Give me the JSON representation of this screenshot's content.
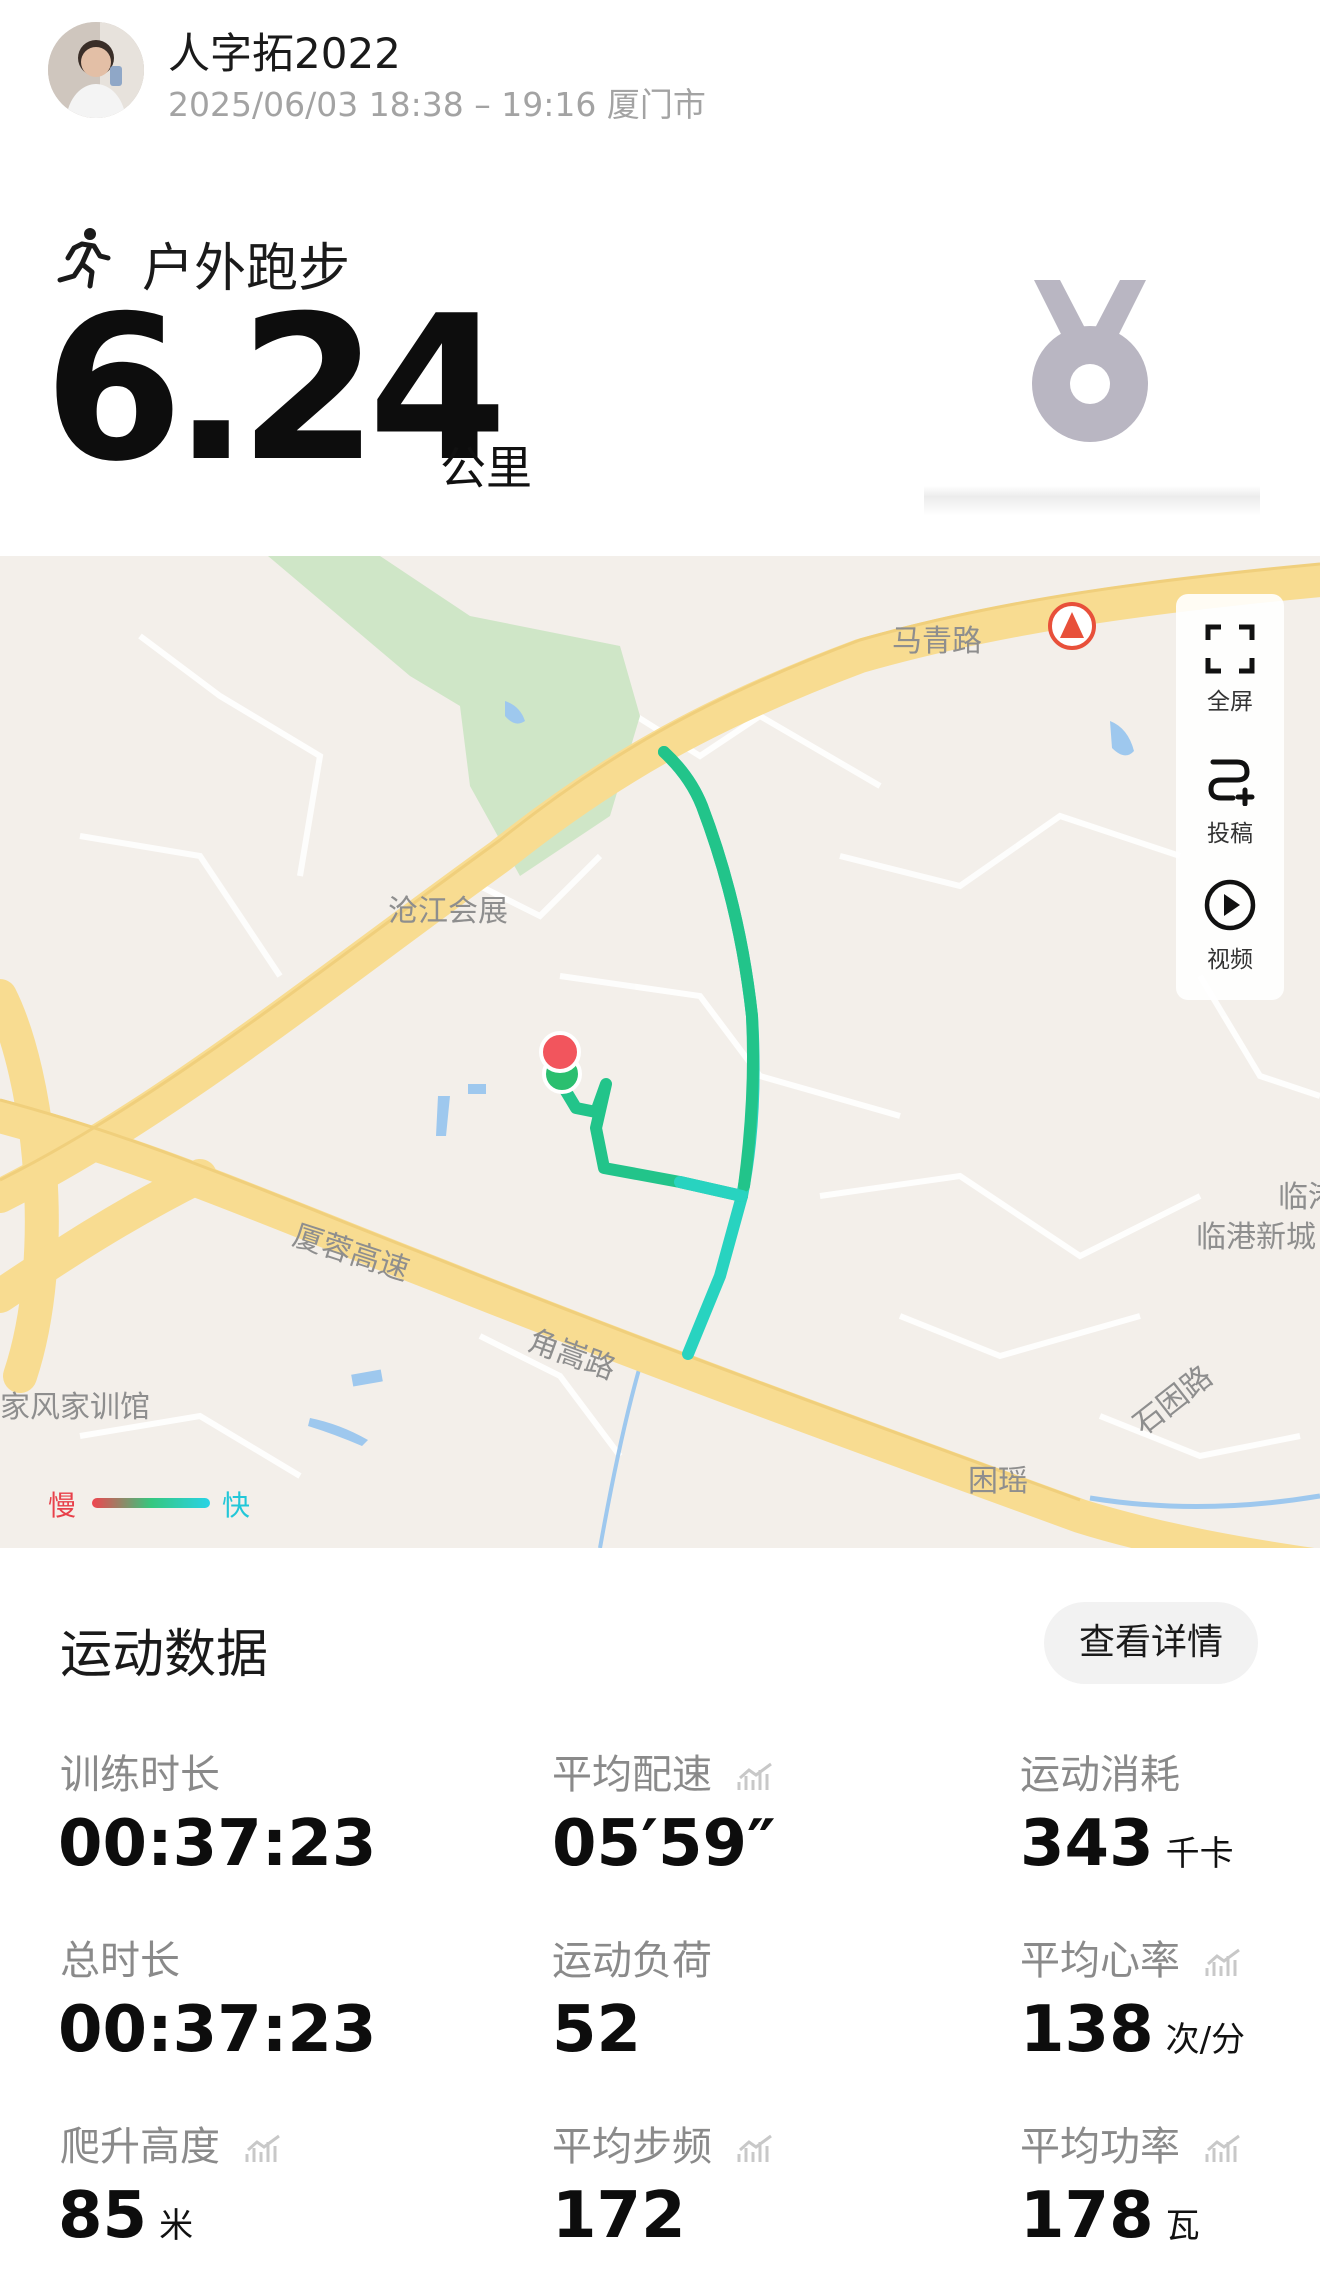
{
  "header": {
    "username": "人字拓2022",
    "datetime": "2025/06/03 18:38 – 19:16 厦门市"
  },
  "workout": {
    "sport_type": "户外跑步",
    "distance": "6.24",
    "distance_unit": "公里"
  },
  "map": {
    "labels": {
      "road_maqing": "马青路",
      "cangjiang": "沧江会展",
      "xiarong": "厦蓉高速",
      "jiaosong": "角嵩路",
      "jiaxun": "家风家训馆",
      "kunyao": "困瑶",
      "shikun": "石困路",
      "lingang": "临港新城",
      "lin_edge": "临港"
    },
    "tools": {
      "fullscreen": "全屏",
      "submit": "投稿",
      "video": "视频"
    },
    "legend": {
      "slow": "慢",
      "fast": "快"
    }
  },
  "stats": {
    "title": "运动数据",
    "details_button": "查看详情",
    "items": [
      {
        "label": "训练时长",
        "value": "00:37:23",
        "unit": ""
      },
      {
        "label": "平均配速",
        "value": "05′59″",
        "unit": ""
      },
      {
        "label": "运动消耗",
        "value": "343",
        "unit": "千卡"
      },
      {
        "label": "总时长",
        "value": "00:37:23",
        "unit": ""
      },
      {
        "label": "运动负荷",
        "value": "52",
        "unit": ""
      },
      {
        "label": "平均心率",
        "value": "138",
        "unit": "次/分"
      },
      {
        "label": "爬升高度",
        "value": "85",
        "unit": "米"
      },
      {
        "label": "平均步频",
        "value": "172",
        "unit": ""
      },
      {
        "label": "平均功率",
        "value": "178",
        "unit": "瓦"
      }
    ]
  },
  "colors": {
    "route": "#22c48a",
    "route_fast": "#28d3e6",
    "road": "#f8dc91",
    "green_area": "#cfe6c7",
    "water": "#9ec8ee",
    "start_marker": "#f2555d",
    "end_marker": "#2bbf6f"
  }
}
